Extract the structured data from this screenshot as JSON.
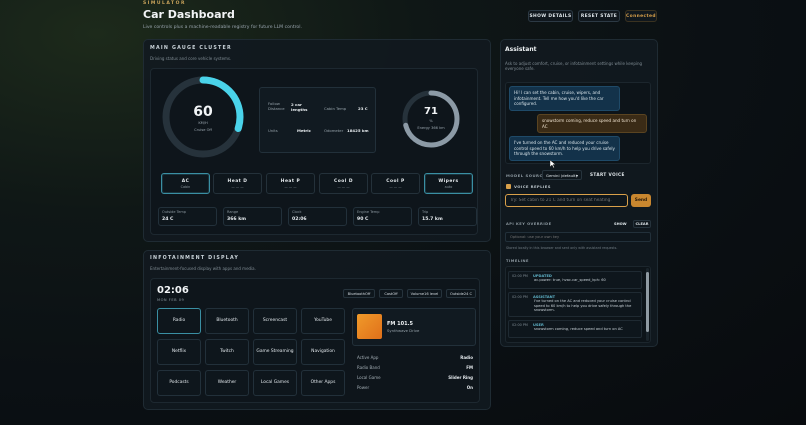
{
  "header": {
    "eyebrow": "SIMULATOR",
    "title": "Car Dashboard",
    "subtitle": "Live controls plus a machine-readable registry for future LLM control.",
    "show_details": "SHOW DETAILS",
    "reset_state": "RESET STATE",
    "status": "Connected"
  },
  "cluster": {
    "title": "MAIN GAUGE CLUSTER",
    "subtitle": "Driving status and core vehicle systems.",
    "speed": {
      "value": "60",
      "unit": "KM/H",
      "mode": "Cruise Off",
      "fraction": 0.3
    },
    "energy": {
      "value": "71",
      "unit": "%",
      "range": "Energy 366 km",
      "fraction": 0.71
    },
    "info": [
      {
        "label": "Follow Distance",
        "value": "2 car lengths"
      },
      {
        "label": "Cabin Temp",
        "value": "23 C"
      },
      {
        "label": "Units",
        "value": "Metric"
      },
      {
        "label": "Odometer",
        "value": "18425 km"
      }
    ],
    "controls": [
      {
        "title": "AC",
        "sub": "Cabin",
        "active": true
      },
      {
        "title": "Heat D",
        "sub": "— — —",
        "active": false
      },
      {
        "title": "Heat P",
        "sub": "— — —",
        "active": false
      },
      {
        "title": "Cool D",
        "sub": "— — —",
        "active": false
      },
      {
        "title": "Cool P",
        "sub": "— — —",
        "active": false
      },
      {
        "title": "Wipers",
        "sub": "auto",
        "active": true
      }
    ],
    "stats": [
      {
        "label": "Outside Temp",
        "value": "24 C"
      },
      {
        "label": "Range",
        "value": "366 km"
      },
      {
        "label": "Clock",
        "value": "02:06"
      },
      {
        "label": "Engine Temp",
        "value": "90 C"
      },
      {
        "label": "Trip",
        "value": "15.7 km"
      }
    ]
  },
  "infotainment": {
    "title": "INFOTAINMENT DISPLAY",
    "subtitle": "Entertainment-focused display with apps and media.",
    "time": "02:06",
    "date": "MON FEB 09",
    "chips": [
      "BluetoothOff",
      "CastOff",
      "Volume16 level",
      "Outside24 C"
    ],
    "apps": [
      {
        "label": "Radio",
        "active": true
      },
      {
        "label": "Bluetooth"
      },
      {
        "label": "Screencast"
      },
      {
        "label": "YouTube"
      },
      {
        "label": "Netflix"
      },
      {
        "label": "Twitch"
      },
      {
        "label": "Game Streaming"
      },
      {
        "label": "Navigation"
      },
      {
        "label": "Podcasts"
      },
      {
        "label": "Weather"
      },
      {
        "label": "Local Games"
      },
      {
        "label": "Other Apps"
      }
    ],
    "now_playing": {
      "station": "FM 101.5",
      "artist": "Synthwave Drive"
    },
    "details": [
      {
        "label": "Active App",
        "value": "Radio"
      },
      {
        "label": "Radio Band",
        "value": "FM"
      },
      {
        "label": "Local Game",
        "value": "Slider Ring"
      },
      {
        "label": "Power",
        "value": "On"
      }
    ]
  },
  "assistant": {
    "title": "Assistant",
    "intro": "Ask to adjust comfort, cruise, or infotainment settings while keeping everyone safe.",
    "messages": [
      {
        "role": "ai",
        "text": "Hi! I can set the cabin, cruise, wipers, and infotainment. Tell me how you'd like the car configured."
      },
      {
        "role": "user",
        "text": "snowstorm coming, reduce speed and turn on AC"
      },
      {
        "role": "ai",
        "text": "I've turned on the AC and reduced your cruise control speed to 60 km/h to help you drive safely through the snowstorm."
      }
    ],
    "model_label": "MODEL SOURCE",
    "model_value": "Gemini (default)",
    "start_voice": "START VOICE",
    "voice_replies": "VOICE REPLIES",
    "input_placeholder": "Try: Set cabin to 21 C and turn on seat heating.",
    "send": "Send",
    "api_label": "API KEY OVERRIDE",
    "show": "SHOW",
    "clear": "CLEAR",
    "api_placeholder": "Optional: use your own key",
    "api_note": "Stored locally in this browser and sent only with assistant requests.",
    "timeline_label": "TIMELINE",
    "timeline": [
      {
        "time": "02:00 PM",
        "type": "UPDATED",
        "text": "ac.power: true, hvac.car_speed_kph: 60"
      },
      {
        "time": "02:00 PM",
        "type": "ASSISTANT",
        "text": "I've turned on the AC and reduced your cruise control speed to 60 km/h to help you drive safely through the snowstorm."
      },
      {
        "time": "02:00 PM",
        "type": "USER",
        "text": "snowstorm coming, reduce speed and turn on AC"
      }
    ]
  },
  "colors": {
    "accent": "#4ad3ea",
    "brand": "#d9a04a",
    "energy": "#8c9aa6"
  }
}
